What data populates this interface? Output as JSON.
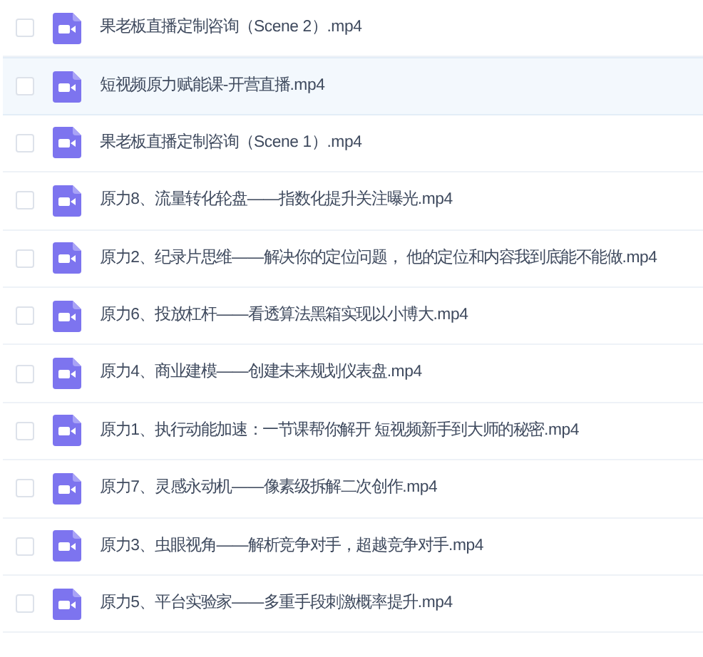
{
  "files": [
    {
      "name": "果老板直播定制咨询（Scene 2）.mp4",
      "checked": false,
      "highlighted": false
    },
    {
      "name": "短视频原力赋能课-开营直播.mp4",
      "checked": false,
      "highlighted": true
    },
    {
      "name": "果老板直播定制咨询（Scene 1）.mp4",
      "checked": false,
      "highlighted": false
    },
    {
      "name": "原力8、流量转化轮盘——指数化提升关注曝光.mp4",
      "checked": false,
      "highlighted": false
    },
    {
      "name": "原力2、纪录片思维——解决你的定位问题， 他的定位和内容我到底能不能做.mp4",
      "checked": false,
      "highlighted": false
    },
    {
      "name": "原力6、投放杠杆——看透算法黑箱实现以小博大.mp4",
      "checked": false,
      "highlighted": false
    },
    {
      "name": "原力4、商业建模——创建未来规划仪表盘.mp4",
      "checked": false,
      "highlighted": false
    },
    {
      "name": "原力1、执行动能加速：一节课帮你解开 短视频新手到大师的秘密.mp4",
      "checked": false,
      "highlighted": false
    },
    {
      "name": "原力7、灵感永动机——像素级拆解二次创作.mp4",
      "checked": false,
      "highlighted": false
    },
    {
      "name": "原力3、虫眼视角——解析竞争对手，超越竞争对手.mp4",
      "checked": false,
      "highlighted": false
    },
    {
      "name": "原力5、平台实验家——多重手段刺激概率提升.mp4",
      "checked": false,
      "highlighted": false
    }
  ]
}
